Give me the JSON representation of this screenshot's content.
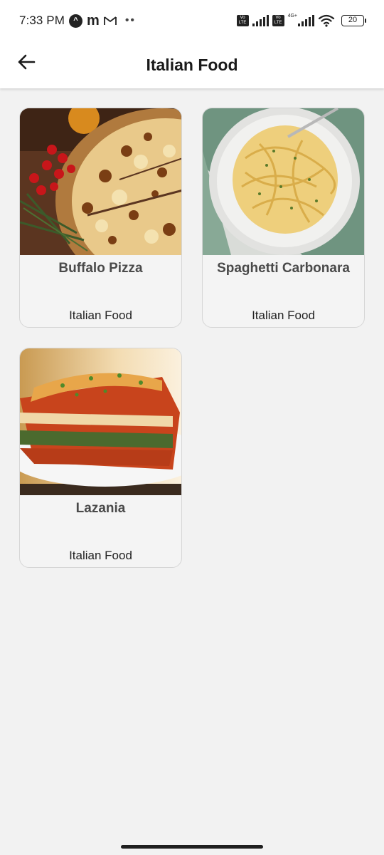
{
  "status_bar": {
    "time": "7:33 PM",
    "battery": "20",
    "network_label": "4G+",
    "volte_label": "Vo LTE",
    "icons": [
      "notification-a-icon",
      "notification-m-icon",
      "gmail-icon",
      "more-dots-icon",
      "volte-icon",
      "signal-icon",
      "wifi-icon",
      "battery-icon"
    ]
  },
  "header": {
    "title": "Italian Food",
    "back_icon": "arrow-left-icon"
  },
  "foods": [
    {
      "name": "Buffalo Pizza",
      "category": "Italian Food",
      "image": "pizza-photo"
    },
    {
      "name": "Spaghetti Carbonara",
      "category": "Italian Food",
      "image": "pasta-photo"
    },
    {
      "name": "Lazania",
      "category": "Italian Food",
      "image": "lasagna-photo"
    }
  ],
  "colors": {
    "background": "#f2f2f2",
    "bar": "#ffffff",
    "card": "#f4f4f4",
    "card_border": "#d6d6d6",
    "title_text": "#4a4a4a"
  }
}
